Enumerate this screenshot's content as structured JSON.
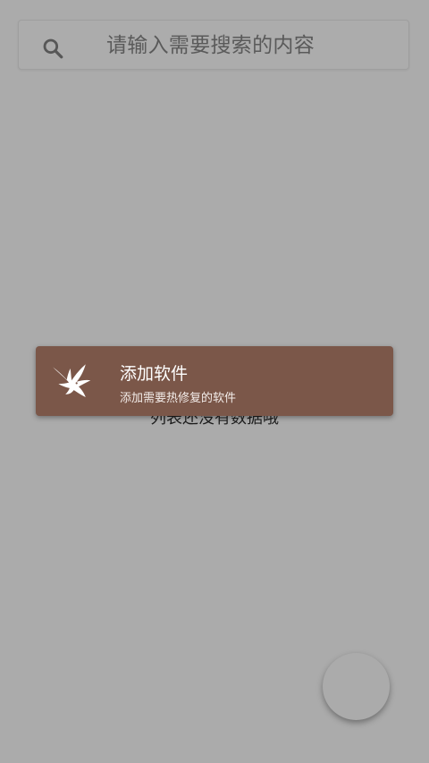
{
  "search": {
    "icon": "search-icon",
    "placeholder": "请输入需要搜索的内容"
  },
  "main": {
    "empty_message": "列表还没有数据哦"
  },
  "toast": {
    "icon": "eagle-icon",
    "title": "添加软件",
    "subtitle": "添加需要热修复的软件",
    "background_color": "#7b5749"
  },
  "fab": {
    "icon": "",
    "background_color": "#ababab"
  },
  "colors": {
    "background": "#ababab",
    "text_primary": "#1f1f1f",
    "text_secondary": "#5a5a5a",
    "toast_text": "#ffffff"
  }
}
